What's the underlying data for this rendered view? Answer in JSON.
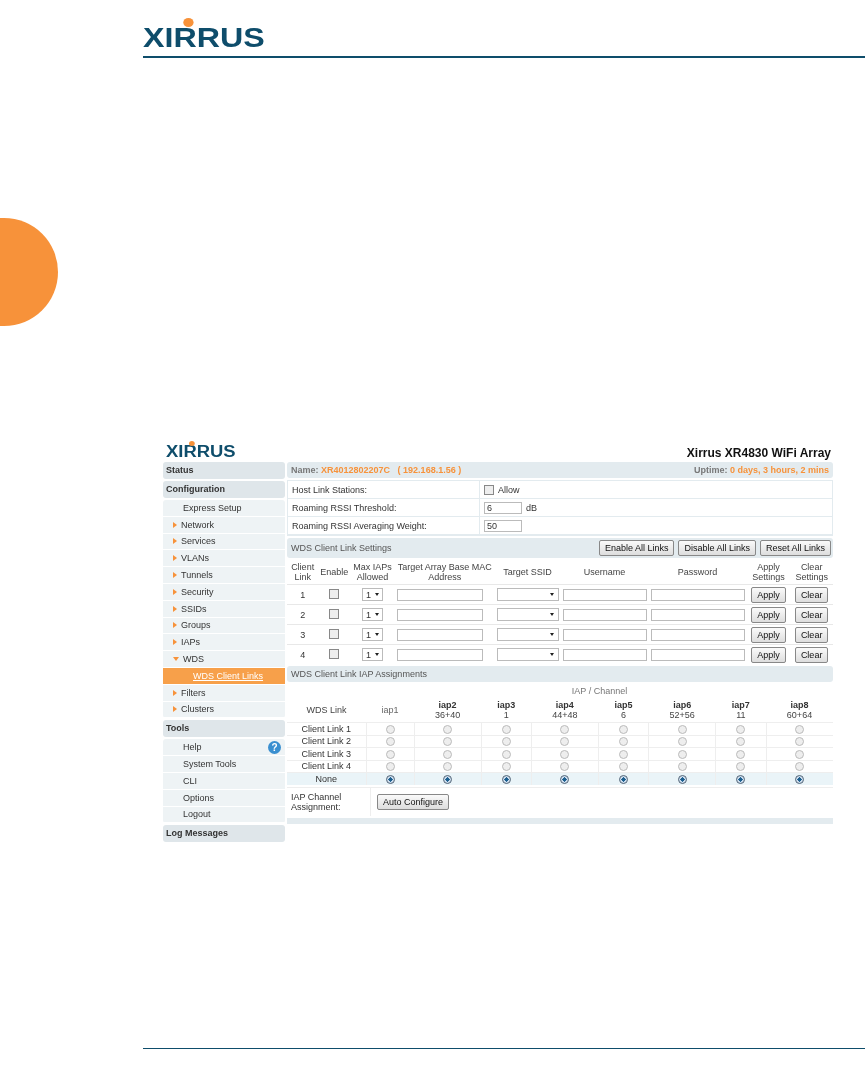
{
  "page_header": {
    "logo": "XIRRUS"
  },
  "screenshot": {
    "logo": "XIRRUS",
    "title": "Xirrus XR4830 WiFi Array",
    "sidebar": [
      {
        "title": "Status"
      },
      {
        "title": "Configuration",
        "items": [
          {
            "label": "Express Setup",
            "kind": "plain",
            "selected": false
          },
          {
            "label": "Network",
            "kind": "folder",
            "expanded": false,
            "selected": false
          },
          {
            "label": "Services",
            "kind": "folder",
            "expanded": false,
            "selected": false
          },
          {
            "label": "VLANs",
            "kind": "folder",
            "expanded": false,
            "selected": false
          },
          {
            "label": "Tunnels",
            "kind": "folder",
            "expanded": false,
            "selected": false
          },
          {
            "label": "Security",
            "kind": "folder",
            "expanded": false,
            "selected": false
          },
          {
            "label": "SSIDs",
            "kind": "folder",
            "expanded": false,
            "selected": false
          },
          {
            "label": "Groups",
            "kind": "folder",
            "expanded": false,
            "selected": false
          },
          {
            "label": "IAPs",
            "kind": "folder",
            "expanded": false,
            "selected": false
          },
          {
            "label": "WDS",
            "kind": "folder",
            "expanded": true,
            "selected": false,
            "children": [
              {
                "label": "WDS Client Links",
                "selected": true
              }
            ]
          },
          {
            "label": "Filters",
            "kind": "folder",
            "expanded": false,
            "selected": false
          },
          {
            "label": "Clusters",
            "kind": "folder",
            "expanded": false,
            "selected": false
          }
        ]
      },
      {
        "title": "Tools",
        "items": [
          {
            "label": "Help",
            "kind": "help",
            "icon": "?",
            "selected": false
          },
          {
            "label": "System Tools",
            "kind": "plain",
            "selected": false
          },
          {
            "label": "CLI",
            "kind": "plain",
            "selected": false
          },
          {
            "label": "Options",
            "kind": "plain",
            "selected": false
          },
          {
            "label": "Logout",
            "kind": "plain",
            "selected": false
          }
        ]
      },
      {
        "title": "Log Messages"
      }
    ],
    "name_bar": {
      "name_label": "Name:",
      "name": "XR4012802207C",
      "ip": "( 192.168.1.56 )",
      "uptime_label": "Uptime:",
      "uptime": "0 days, 3 hours, 2 mins"
    },
    "settings": [
      {
        "label": "Host Link Stations:",
        "kind": "checkbox",
        "checked": false,
        "text": "Allow"
      },
      {
        "label": "Roaming RSSI Threshold:",
        "kind": "input",
        "value": "6",
        "unit": "dB"
      },
      {
        "label": "Roaming RSSI Averaging Weight:",
        "kind": "input",
        "value": "50"
      }
    ],
    "link_settings": {
      "title": "WDS Client Link Settings",
      "buttons": [
        "Enable All Links",
        "Disable All Links",
        "Reset All Links"
      ],
      "columns": [
        "Client Link",
        "Enable",
        "Max IAPs Allowed",
        "Target Array Base MAC Address",
        "Target SSID",
        "Username",
        "Password",
        "Apply Settings",
        "Clear Settings"
      ],
      "rows": [
        {
          "link": "1",
          "enabled": false,
          "max_iaps": "1",
          "apply": "Apply",
          "clear": "Clear"
        },
        {
          "link": "2",
          "enabled": false,
          "max_iaps": "1",
          "apply": "Apply",
          "clear": "Clear"
        },
        {
          "link": "3",
          "enabled": false,
          "max_iaps": "1",
          "apply": "Apply",
          "clear": "Clear"
        },
        {
          "link": "4",
          "enabled": false,
          "max_iaps": "1",
          "apply": "Apply",
          "clear": "Clear"
        }
      ]
    },
    "assignments": {
      "title": "WDS Client Link IAP Assignments",
      "group_heading": "IAP / Channel",
      "link_heading": "WDS Link",
      "iaps": [
        {
          "name": "iap1",
          "enabled": false
        },
        {
          "name": "iap2",
          "channel": "36+40",
          "enabled": true
        },
        {
          "name": "iap3",
          "channel": "1",
          "enabled": true
        },
        {
          "name": "iap4",
          "channel": "44+48",
          "enabled": true
        },
        {
          "name": "iap5",
          "channel": "6",
          "enabled": true
        },
        {
          "name": "iap6",
          "channel": "52+56",
          "enabled": true
        },
        {
          "name": "iap7",
          "channel": "11",
          "enabled": true
        },
        {
          "name": "iap8",
          "channel": "60+64",
          "enabled": true
        }
      ],
      "rows": [
        {
          "label": "Client Link 1",
          "highlighted": false,
          "cells": [
            {
              "selected": false
            },
            {
              "selected": false
            },
            {
              "selected": false
            },
            {
              "selected": false
            },
            {
              "selected": false
            },
            {
              "selected": false
            },
            {
              "selected": false
            },
            {
              "selected": false
            }
          ]
        },
        {
          "label": "Client Link 2",
          "highlighted": false,
          "cells": [
            {
              "selected": false
            },
            {
              "selected": false
            },
            {
              "selected": false
            },
            {
              "selected": false
            },
            {
              "selected": false
            },
            {
              "selected": false
            },
            {
              "selected": false
            },
            {
              "selected": false
            }
          ]
        },
        {
          "label": "Client Link 3",
          "highlighted": false,
          "cells": [
            {
              "selected": false
            },
            {
              "selected": false
            },
            {
              "selected": false
            },
            {
              "selected": false
            },
            {
              "selected": false
            },
            {
              "selected": false
            },
            {
              "selected": false
            },
            {
              "selected": false
            }
          ]
        },
        {
          "label": "Client Link 4",
          "highlighted": false,
          "cells": [
            {
              "selected": false
            },
            {
              "selected": false
            },
            {
              "selected": false
            },
            {
              "selected": false
            },
            {
              "selected": false
            },
            {
              "selected": false
            },
            {
              "selected": false
            },
            {
              "selected": false
            }
          ]
        },
        {
          "label": "None",
          "highlighted": true,
          "cells": [
            {
              "selected": true
            },
            {
              "selected": true
            },
            {
              "selected": true
            },
            {
              "selected": true
            },
            {
              "selected": true
            },
            {
              "selected": true
            },
            {
              "selected": true
            },
            {
              "selected": true
            }
          ]
        }
      ],
      "footer_label": "IAP Channel Assignment:",
      "footer_button": "Auto Configure"
    }
  }
}
